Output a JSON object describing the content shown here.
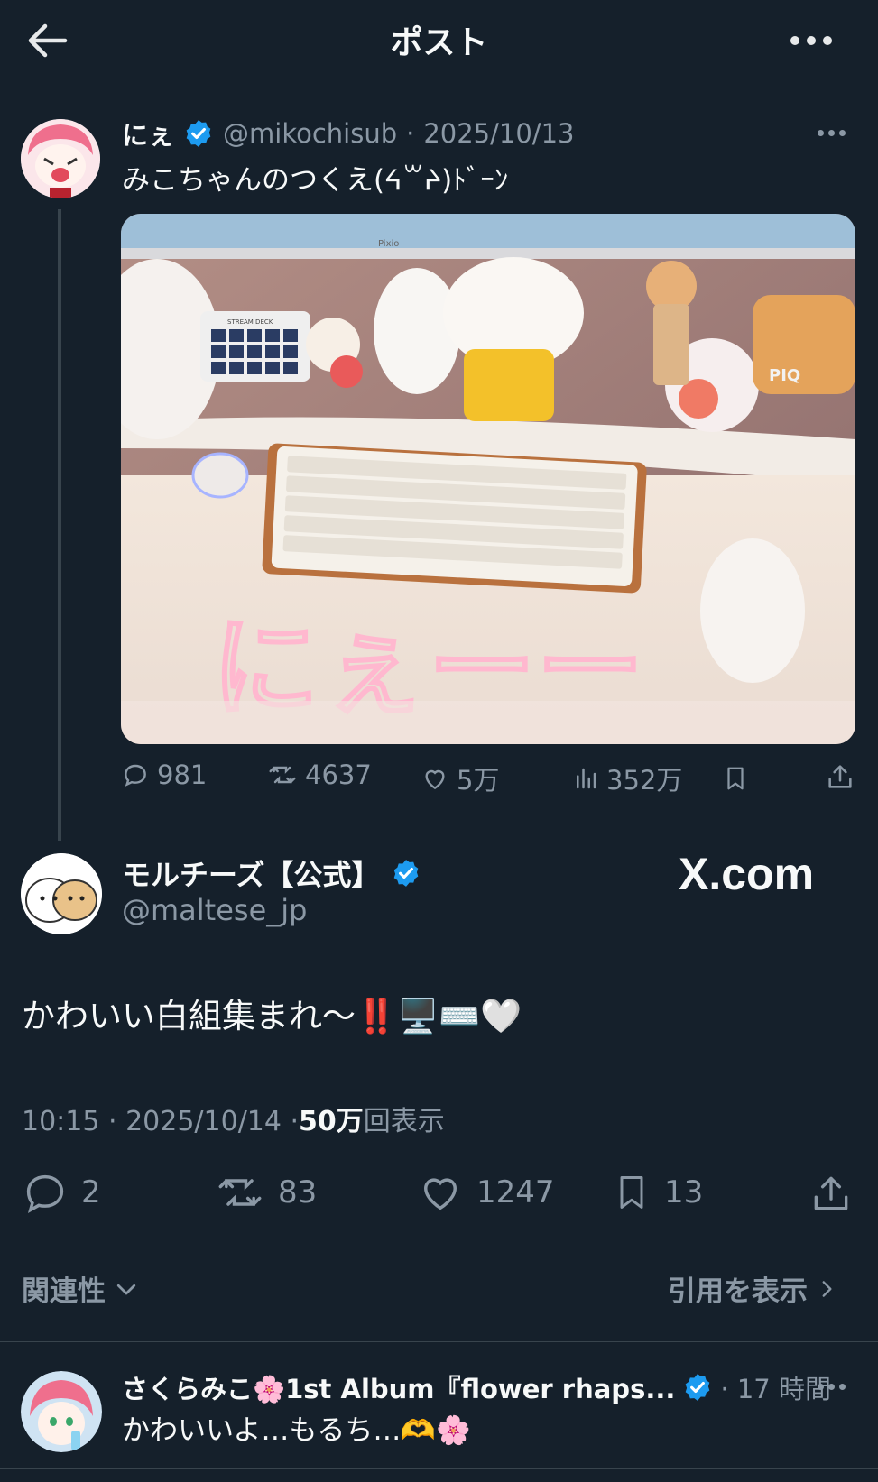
{
  "header": {
    "title": "ポスト"
  },
  "quoted": {
    "name": "にぇ",
    "handle": "@mikochisub",
    "dot": "·",
    "date": "2025/10/13",
    "text": "みこちゃんのつくえ(ᔦ꒳ᔨ)ﾄﾞｰﾝ",
    "image_text": "にぇーー",
    "image_monitor": "Pixio",
    "image_deck": "STREAM DECK",
    "image_mug": "PIQ",
    "stats": {
      "replies": "981",
      "retweets": "4637",
      "likes": "5万",
      "views": "352万"
    }
  },
  "post": {
    "name": "モルチーズ【公式】",
    "handle": "@maltese_jp",
    "watermark": "X.com",
    "text": "かわいい白組集まれ〜‼️🖥️⌨️🤍",
    "time": "10:15 · 2025/10/14 · ",
    "views_count": "50万",
    "views_label": "回表示",
    "stats": {
      "replies": "2",
      "retweets": "83",
      "likes": "1247",
      "bookmarks": "13"
    }
  },
  "sort": {
    "label": "関連性",
    "quotes_link": "引用を表示"
  },
  "reply": {
    "name": "さくらみこ🌸1st Album『flower rhaps...",
    "time": "· 17 時間",
    "text": "かわいいよ…もるち…🫶🌸"
  },
  "colors": {
    "background": "#15202b",
    "verified": "#1d9bf0",
    "muted": "#8b98a5",
    "text": "#e7e9ea"
  }
}
